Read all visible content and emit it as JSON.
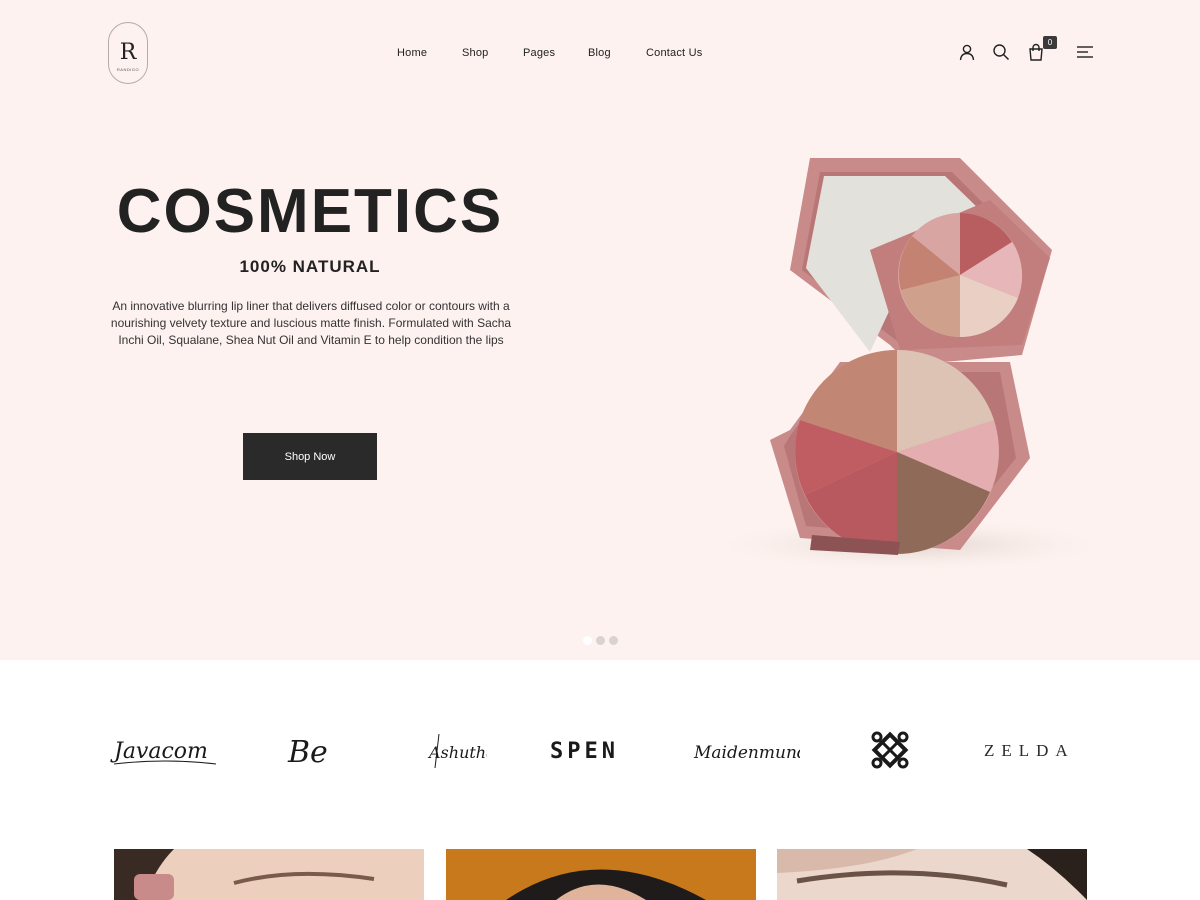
{
  "header": {
    "logo_letter": "R",
    "logo_sub": "RANDIGO",
    "nav": [
      "Home",
      "Shop",
      "Pages",
      "Blog",
      "Contact Us"
    ],
    "cart_count": "0",
    "icons": [
      "user-icon",
      "search-icon",
      "cart-icon",
      "menu-icon"
    ]
  },
  "hero": {
    "title": "COSMETICS",
    "subtitle": "100% NATURAL",
    "description": "An innovative blurring lip liner that delivers diffused color or contours with a nourishing velvety texture and luscious matte finish. Formulated with Sacha Inchi Oil, Squalane, Shea Nut Oil and Vitamin E to help condition the lips",
    "button": "Shop Now",
    "slides": 3,
    "active_slide": 1
  },
  "brands": [
    "Javacom",
    "Be",
    "Ashutha",
    "SPEN",
    "Maidenmundo",
    "logo-mark",
    "ZELDA"
  ],
  "colors": {
    "hero_bg": "#fdf2ef",
    "button_bg": "#2a2a2a",
    "compact_pink": "#c98a8a"
  }
}
